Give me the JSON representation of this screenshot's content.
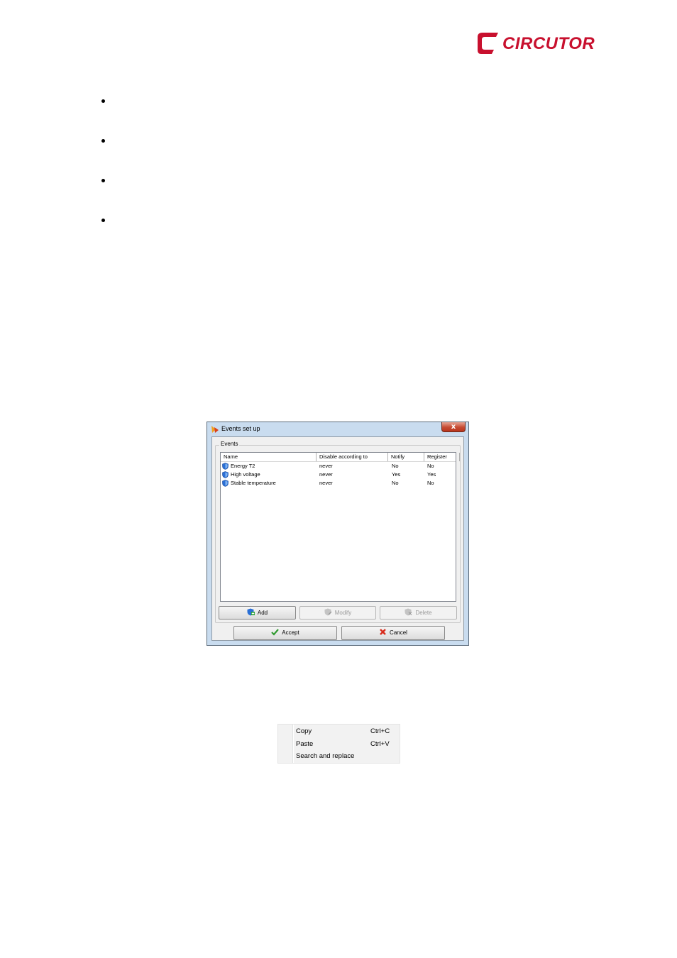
{
  "logo": {
    "text": "CIRCUTOR",
    "brand_color": "#c8102e"
  },
  "dialog": {
    "title": "Events set up",
    "close_label": "x",
    "group_label": "Events",
    "columns": [
      "Name",
      "Disable according to",
      "Notify",
      "Register"
    ],
    "rows": [
      {
        "name": "Energy T2",
        "disable": "never",
        "notify": "No",
        "register": "No"
      },
      {
        "name": "High voltage",
        "disable": "never",
        "notify": "Yes",
        "register": "Yes"
      },
      {
        "name": "Stable temperature",
        "disable": "never",
        "notify": "No",
        "register": "No"
      }
    ],
    "buttons": {
      "add": "Add",
      "modify": "Modify",
      "delete": "Delete",
      "accept": "Accept",
      "cancel": "Cancel"
    }
  },
  "context_menu": {
    "items": [
      {
        "label": "Copy",
        "shortcut": "Ctrl+C"
      },
      {
        "label": "Paste",
        "shortcut": "Ctrl+V"
      },
      {
        "label": "Search and replace",
        "shortcut": ""
      }
    ]
  }
}
